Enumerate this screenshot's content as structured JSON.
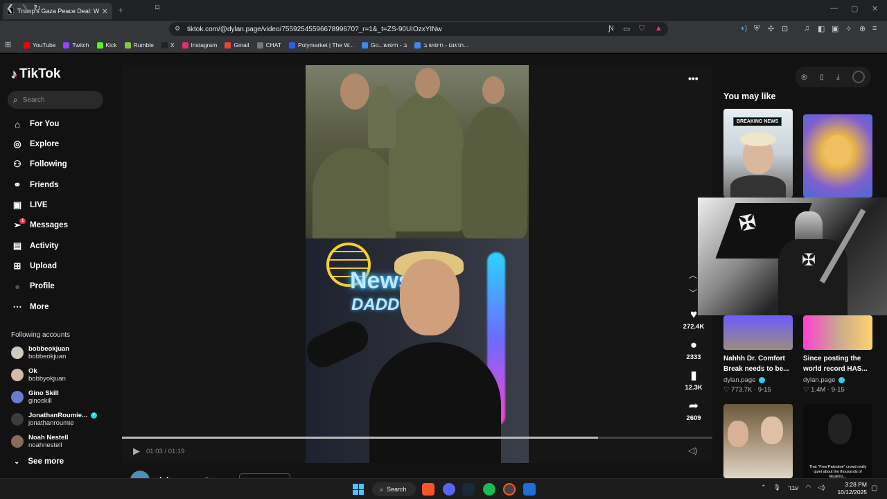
{
  "browser": {
    "tab_title": "Trump's Gaza Peace Deal: What",
    "url": "tiktok.com/@dylan.page/video/7559254559667899670?_r=1&_t=ZS-90UIOzxYINw",
    "bookmarks": [
      {
        "label": "YouTube",
        "color": "#ff0000"
      },
      {
        "label": "Twitch",
        "color": "#9146ff"
      },
      {
        "label": "Kick",
        "color": "#53fc18"
      },
      {
        "label": "Rumble",
        "color": "#85c742"
      },
      {
        "label": "X",
        "color": "#222222"
      },
      {
        "label": "Instagram",
        "color": "#e1306c"
      },
      {
        "label": "Gmail",
        "color": "#ea4335"
      },
      {
        "label": "CHAT",
        "color": "#777777"
      },
      {
        "label": "Polymarket | The W...",
        "color": "#2e5cff"
      },
      {
        "label": "Go...ב - חיפוש",
        "color": "#4285f4"
      },
      {
        "label": "תרגום - חיפוש ב...",
        "color": "#4285f4"
      }
    ]
  },
  "tiktok": {
    "logo": "TikTok",
    "search_placeholder": "Search",
    "nav": [
      {
        "label": "For You",
        "icon": "home-icon"
      },
      {
        "label": "Explore",
        "icon": "compass-icon"
      },
      {
        "label": "Following",
        "icon": "user-follow-icon"
      },
      {
        "label": "Friends",
        "icon": "friends-icon"
      },
      {
        "label": "LIVE",
        "icon": "live-icon"
      },
      {
        "label": "Messages",
        "icon": "messages-icon",
        "badge": "1"
      },
      {
        "label": "Activity",
        "icon": "activity-icon"
      },
      {
        "label": "Upload",
        "icon": "upload-icon"
      },
      {
        "label": "Profile",
        "icon": "avatar-icon"
      },
      {
        "label": "More",
        "icon": "more-icon"
      }
    ],
    "following_title": "Following accounts",
    "accounts": [
      {
        "name": "bobbeokjuan",
        "handle": "bobbeokjuan",
        "verified": false
      },
      {
        "name": "Ok",
        "handle": "bobbyokjuan",
        "verified": false
      },
      {
        "name": "Gino Skill",
        "handle": "ginoskill",
        "verified": false
      },
      {
        "name": "JonathanRoumie...",
        "handle": "jonathanroumie",
        "verified": true
      },
      {
        "name": "Noah Nestell",
        "handle": "noahnestell",
        "verified": false
      }
    ],
    "see_more": "See more"
  },
  "video": {
    "neon_text_1": "News",
    "neon_text_2": "DADD",
    "likes": "272.4K",
    "comments": "2333",
    "saves": "12.3K",
    "shares": "2609",
    "time": "01:03 / 01:19",
    "progress": 0.806,
    "author": "dylan.page"
  },
  "right": {
    "title": "You may like",
    "thumb1_label": "BREAKING NEWS",
    "cards": [
      {
        "caption": "Nahhh Dr. Comfort Break needs to be...",
        "author": "dylan.page",
        "stats": "♡ 773.7K · 9-15"
      },
      {
        "caption": "Since posting the world record HAS...",
        "author": "dylan.page",
        "stats": "♡ 1.4M · 9-15"
      }
    ],
    "thumb4_text": "That \"Free Palestine\" crowd really quiet about the thousands of Muslims..."
  },
  "taskbar": {
    "search": "Search",
    "lang": "עבר",
    "time": "3:28 PM",
    "date": "10/12/2025"
  }
}
